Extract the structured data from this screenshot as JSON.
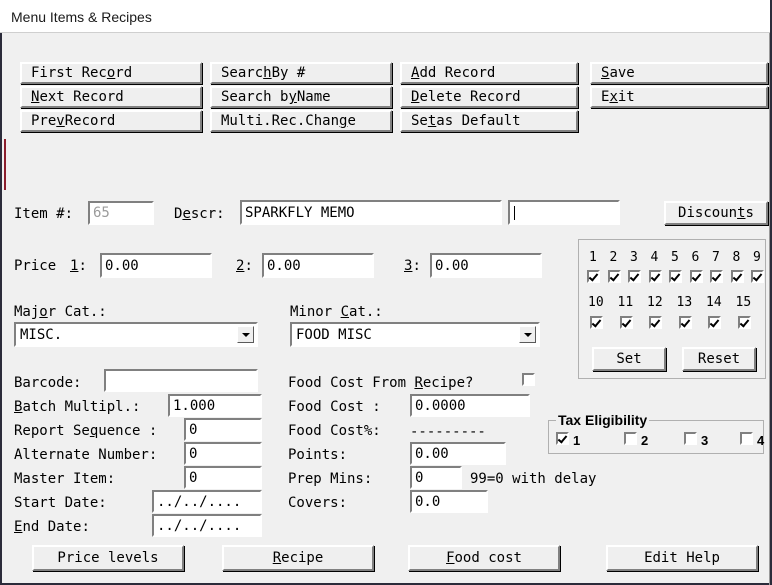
{
  "window": {
    "title": "Menu Items & Recipes"
  },
  "toolbar": {
    "buttons": [
      {
        "label": "First Record",
        "accel_index": 9,
        "col": 0,
        "row": 0
      },
      {
        "label": "Next Record",
        "accel_index": 0,
        "col": 0,
        "row": 1
      },
      {
        "label": "Prev Record",
        "accel_index": 3,
        "col": 0,
        "row": 2
      },
      {
        "label": "Search By #",
        "accel_index": 5,
        "col": 1,
        "row": 0
      },
      {
        "label": "Search by Name",
        "accel_index": 8,
        "col": 1,
        "row": 1
      },
      {
        "label": "Multi.Rec.Change",
        "accel_index": 14,
        "col": 1,
        "row": 2
      },
      {
        "label": "Add Record",
        "accel_index": 0,
        "col": 2,
        "row": 0
      },
      {
        "label": "Delete Record",
        "accel_index": 0,
        "col": 2,
        "row": 1
      },
      {
        "label": "Set as Default",
        "accel_index": 2,
        "col": 2,
        "row": 2
      },
      {
        "label": "Save",
        "accel_index": 0,
        "col": 3,
        "row": 0
      },
      {
        "label": "Exit",
        "accel_index": 1,
        "col": 3,
        "row": 1
      }
    ]
  },
  "identity": {
    "item_number_label": "Item #:",
    "item_number_value": "65",
    "descr_label": "Descr:",
    "descr_accel_index": 1,
    "descr_value": "SPARKFLY MEMO",
    "descr2_value": "",
    "discounts_button": "Discounts",
    "discounts_accel_index": 7
  },
  "prices": {
    "label": "Price",
    "p1_label": "1:",
    "p1_value": "0.00",
    "p2_label": "2:",
    "p2_value": "0.00",
    "p3_label": "3:",
    "p3_value": "0.00"
  },
  "discount_grid": {
    "numbers_row1": [
      "1",
      "2",
      "3",
      "4",
      "5",
      "6",
      "7",
      "8",
      "9"
    ],
    "numbers_row2": [
      "10",
      "11",
      "12",
      "13",
      "14",
      "15"
    ],
    "checked_row1": [
      true,
      true,
      true,
      true,
      true,
      true,
      true,
      true,
      true
    ],
    "checked_row2": [
      true,
      true,
      true,
      true,
      true,
      true
    ],
    "set_button": "Set",
    "reset_button": "Reset"
  },
  "categories": {
    "major_label": "Major Cat.:",
    "major_accel_index": 3,
    "major_value": "MISC.",
    "minor_label": "Minor Cat.:",
    "minor_accel_index": 6,
    "minor_value": "FOOD MISC"
  },
  "left_fields": {
    "barcode_label": "Barcode:",
    "barcode_value": "",
    "batch_label": "Batch Multipl.:",
    "batch_accel_index": 0,
    "batch_value": "1.000",
    "report_seq_label": "Report Sequence :",
    "report_seq_accel_index": 9,
    "report_seq_value": "0",
    "alt_number_label": "Alternate Number:",
    "alt_number_value": "0",
    "master_item_label": "Master Item:",
    "master_item_value": "0",
    "start_date_label": "Start Date:",
    "start_date_value": "../../....",
    "end_date_label": "End Date:",
    "end_date_accel_index": 0,
    "end_date_value": "../../...."
  },
  "cost_fields": {
    "from_recipe_label": "Food Cost From Recipe?",
    "from_recipe_accel_index": 15,
    "from_recipe_checked": false,
    "food_cost_label": "Food Cost :",
    "food_cost_value": "0.0000",
    "food_cost_pct_label": "Food Cost%:",
    "food_cost_pct_value": "---------",
    "points_label": "Points:",
    "points_value": "0.00",
    "prep_mins_label": "Prep Mins:",
    "prep_mins_value": "0",
    "prep_mins_hint": "99=0 with delay",
    "covers_label": "Covers:",
    "covers_value": "0.0"
  },
  "tax_eligibility": {
    "title": "Tax Eligibility",
    "options": [
      {
        "label": "1",
        "checked": true
      },
      {
        "label": "2",
        "checked": false
      },
      {
        "label": "3",
        "checked": false
      },
      {
        "label": "4",
        "checked": false
      }
    ]
  },
  "bottom_buttons": [
    {
      "label": "Price levels",
      "accel_index": -1
    },
    {
      "label": "Recipe",
      "accel_index": 0
    },
    {
      "label": "Food cost",
      "accel_index": 0
    },
    {
      "label": "Edit Help",
      "accel_index": -1
    }
  ],
  "colors": {
    "face": "#f0f0f0",
    "field_bg": "#ffffff",
    "text": "#000000",
    "disabled_text": "#9b9b9b",
    "frame": "#2b2b3a",
    "accent_mark": "#8b1d2c"
  }
}
